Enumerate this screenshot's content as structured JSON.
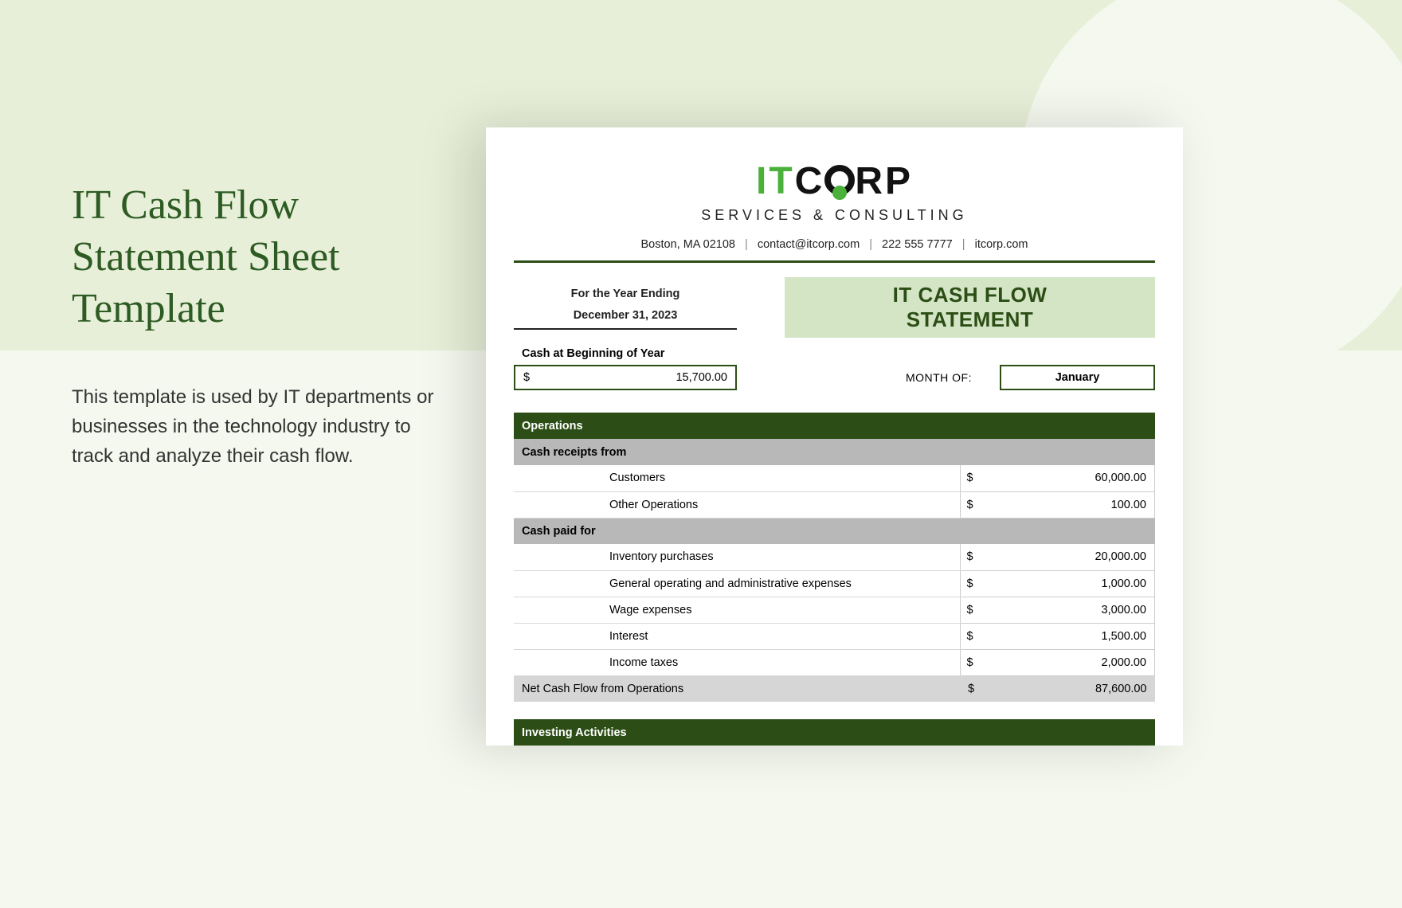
{
  "left": {
    "title": "IT Cash Flow Statement Sheet Template",
    "description": "This template is used by IT departments or businesses in the technology industry to track and analyze their cash flow."
  },
  "logo": {
    "it": "IT",
    "corp_c": "C",
    "corp_rp": "RP",
    "subtitle": "SERVICES & CONSULTING"
  },
  "contact": {
    "address": "Boston, MA 02108",
    "email": "contact@itcorp.com",
    "phone": "222 555 7777",
    "site": "itcorp.com"
  },
  "header": {
    "year_ending_label": "For the Year Ending",
    "year_ending_value": "December 31, 2023",
    "statement_title_1": "IT CASH FLOW",
    "statement_title_2": "STATEMENT"
  },
  "beginning": {
    "label": "Cash at Beginning of Year",
    "currency": "$",
    "amount": "15,700.00",
    "month_label": "MONTH OF:",
    "month_value": "January"
  },
  "sections": {
    "operations_header": "Operations",
    "receipts_header": "Cash receipts from",
    "paid_header": "Cash paid for",
    "investing_header": "Investing Activities"
  },
  "receipts": [
    {
      "label": "Customers",
      "amount": "60,000.00"
    },
    {
      "label": "Other Operations",
      "amount": "100.00"
    }
  ],
  "paid": [
    {
      "label": "Inventory purchases",
      "amount": "20,000.00"
    },
    {
      "label": "General operating and administrative expenses",
      "amount": "1,000.00"
    },
    {
      "label": "Wage expenses",
      "amount": "3,000.00"
    },
    {
      "label": "Interest",
      "amount": "1,500.00"
    },
    {
      "label": "Income taxes",
      "amount": "2,000.00"
    }
  ],
  "net_operations": {
    "label": "Net Cash Flow from Operations",
    "amount": "87,600.00"
  },
  "currency": "$"
}
